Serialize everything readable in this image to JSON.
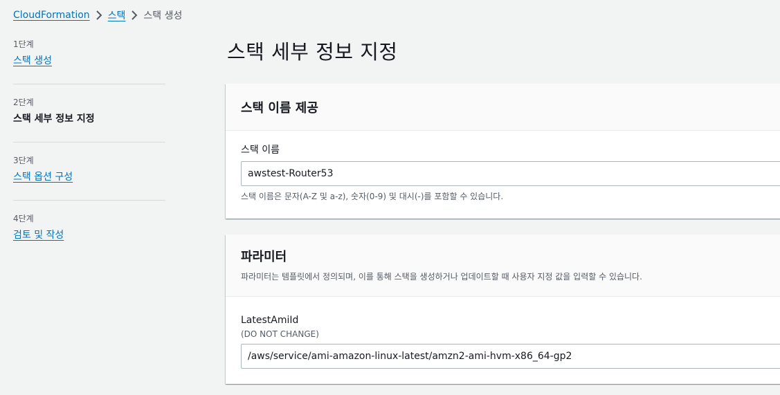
{
  "breadcrumb": {
    "items": [
      "CloudFormation",
      "스택"
    ],
    "current": "스택 생성"
  },
  "steps": [
    {
      "num": "1단계",
      "name": "스택 생성"
    },
    {
      "num": "2단계",
      "name": "스택 세부 정보 지정"
    },
    {
      "num": "3단계",
      "name": "스택 옵션 구성"
    },
    {
      "num": "4단계",
      "name": "검토 및 작성"
    }
  ],
  "page_title": "스택 세부 정보 지정",
  "stack_name_panel": {
    "title": "스택 이름 제공",
    "label": "스택 이름",
    "value": "awstest-Router53",
    "hint": "스택 이름은 문자(A-Z 및 a-z), 숫자(0-9) 및 대시(-)를 포함할 수 있습니다."
  },
  "parameters_panel": {
    "title": "파라미터",
    "description": "파라미터는 템플릿에서 정의되며, 이를 통해 스택을 생성하거나 업데이트할 때 사용자 지정 값을 입력할 수 있습니다.",
    "param_label": "LatestAmiId",
    "param_sub": "(DO NOT CHANGE)",
    "param_value": "/aws/service/ami-amazon-linux-latest/amzn2-ami-hvm-x86_64-gp2"
  },
  "colors": {
    "link": "#0073bb",
    "background": "#f2f3f3"
  },
  "icons": {
    "breadcrumb_separator": "chevron-right-icon"
  }
}
